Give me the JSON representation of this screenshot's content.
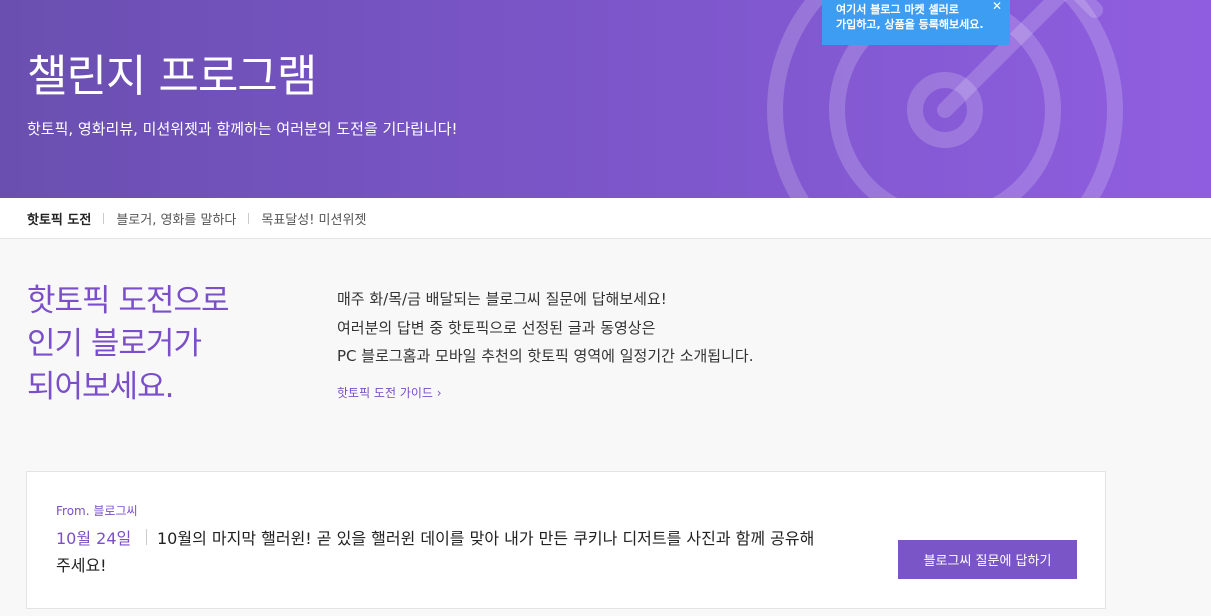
{
  "hero": {
    "title": "챌린지 프로그램",
    "subtitle": "핫토픽, 영화리뷰, 미션위젯과 함께하는 여러분의 도전을 기다립니다!",
    "tooltip_line1": "여기서 블로그 마켓 셀러로",
    "tooltip_line2": "가입하고, 상품을 등록해보세요.",
    "tooltip_close": "✕"
  },
  "tabs": [
    {
      "label": "핫토픽 도전"
    },
    {
      "label": "블로거, 영화를 말하다"
    },
    {
      "label": "목표달성! 미션위젯"
    }
  ],
  "intro": {
    "title_line1": "핫토픽 도전으로",
    "title_line2": "인기 블로거가",
    "title_line3": "되어보세요.",
    "desc_line1": "매주 화/목/금 배달되는 블로그씨 질문에 답해보세요!",
    "desc_line2": "여러분의 답변 중 핫토픽으로 선정된 글과 동영상은",
    "desc_line3": "PC 블로그홈과 모바일 추천의 핫토픽 영역에 일정기간 소개됩니다.",
    "guide_link": "핫토픽 도전 가이드 ›"
  },
  "question_card": {
    "from": "From. 블로그씨",
    "date": "10월 24일",
    "question_line1": "10월의 마지막 핼러윈! 곧 있을 핼러윈 데이를 맞아 내가 만든 쿠키나 디저트를 사진과 함께 공유해",
    "question_line2": "주세요!",
    "answer_button": "블로그씨 질문에 답하기"
  },
  "colors": {
    "accent": "#7a4fc9",
    "tooltip": "#3d9df2"
  }
}
